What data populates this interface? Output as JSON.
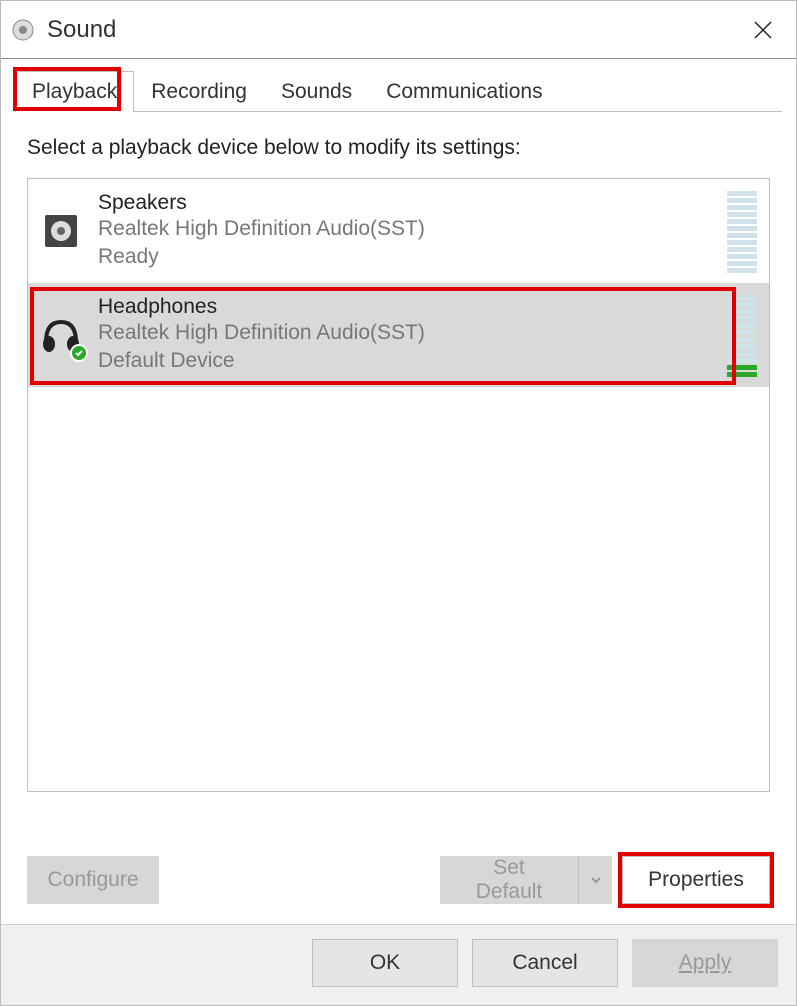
{
  "window": {
    "title": "Sound"
  },
  "tabs": {
    "items": [
      {
        "label": "Playback"
      },
      {
        "label": "Recording"
      },
      {
        "label": "Sounds"
      },
      {
        "label": "Communications"
      }
    ]
  },
  "instruction": "Select a playback device below to modify its settings:",
  "devices": [
    {
      "name": "Speakers",
      "driver": "Realtek High Definition Audio(SST)",
      "status": "Ready"
    },
    {
      "name": "Headphones",
      "driver": "Realtek High Definition Audio(SST)",
      "status": "Default Device"
    }
  ],
  "buttons": {
    "configure": "Configure",
    "setDefault": "Set Default",
    "properties": "Properties",
    "ok": "OK",
    "cancel": "Cancel",
    "apply": "Apply"
  }
}
